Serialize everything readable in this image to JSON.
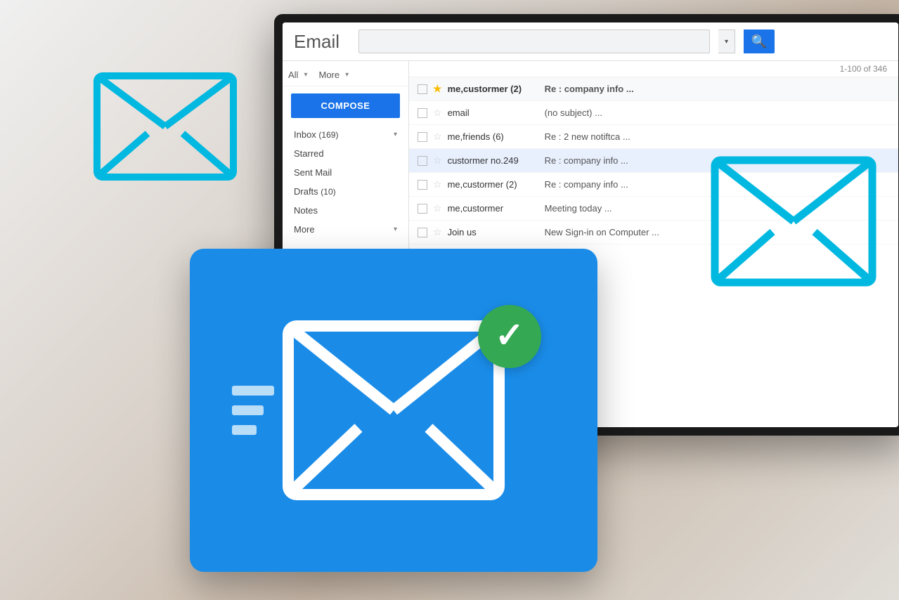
{
  "app": {
    "title": "Email",
    "search_placeholder": "",
    "count_label": "1-100 of 346"
  },
  "toolbar": {
    "all_label": "All",
    "more_label": "More",
    "compose_label": "COMPOSE"
  },
  "nav": {
    "items": [
      {
        "label": "Inbox",
        "count": "(169)",
        "has_chevron": true
      },
      {
        "label": "Starred",
        "count": "",
        "has_chevron": false
      },
      {
        "label": "Sent Mail",
        "count": "",
        "has_chevron": false
      },
      {
        "label": "Drafts",
        "count": "(10)",
        "has_chevron": false
      },
      {
        "label": "Notes",
        "count": "",
        "has_chevron": false
      },
      {
        "label": "More",
        "count": "",
        "has_chevron": true
      }
    ]
  },
  "emails": [
    {
      "sender": "me,custormer (2)",
      "subject": "Re : company info ...",
      "starred": true,
      "unread": true
    },
    {
      "sender": "email",
      "subject": "(no subject) ...",
      "starred": false,
      "unread": false
    },
    {
      "sender": "me,friends (6)",
      "subject": "Re : 2 new notiftca ...",
      "starred": false,
      "unread": false
    },
    {
      "sender": "custormer no.249",
      "subject": "Re : company info ...",
      "starred": false,
      "unread": false,
      "highlighted": true
    },
    {
      "sender": "me,custormer (2)",
      "subject": "Re : company info ...",
      "starred": false,
      "unread": false
    },
    {
      "sender": "me,custormer",
      "subject": "Meeting today ...",
      "starred": false,
      "unread": false
    },
    {
      "sender": "Join us",
      "subject": "New Sign-in on Computer ...",
      "starred": false,
      "unread": false
    }
  ],
  "colors": {
    "blue_primary": "#1a73e8",
    "blue_card": "#1a8ce8",
    "green_check": "#34a853",
    "icon_cyan": "#00b0d8"
  }
}
